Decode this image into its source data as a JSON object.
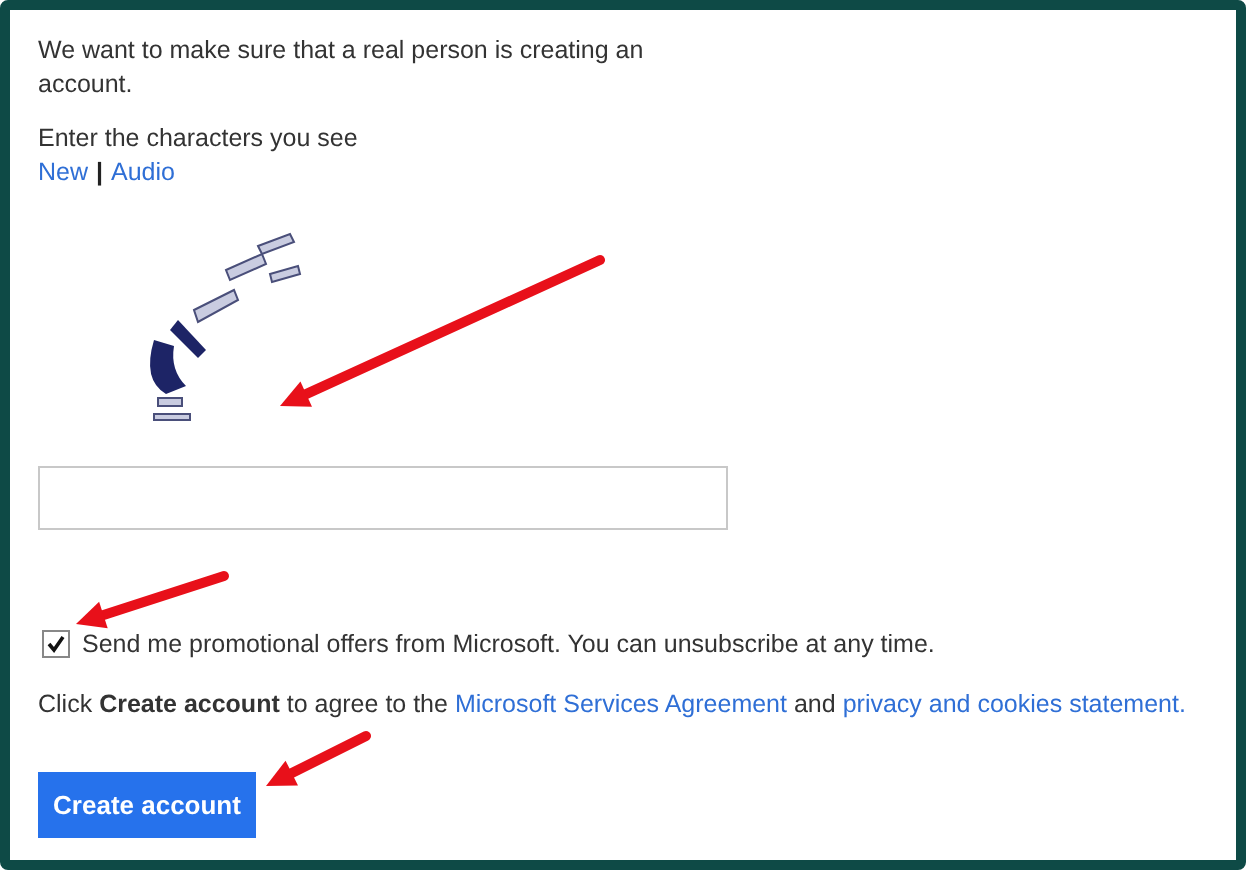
{
  "intro": "We want to make sure that a real person is creating an account.",
  "prompt": "Enter the characters you see",
  "captcha_links": [
    {
      "label": "New"
    },
    {
      "label": "Audio"
    }
  ],
  "captcha_separator": "|",
  "promo": {
    "label": "Send me promotional offers from Microsoft. You can unsubscribe at any time.",
    "checked": true
  },
  "agreement": [
    {
      "kind": "text",
      "text": "Click **Create account** to agree to the"
    },
    {
      "kind": "link",
      "text": "Microsoft Services Agreement"
    },
    {
      "kind": "text",
      "text": "and"
    },
    {
      "kind": "link",
      "text": "privacy and cookies statement."
    }
  ],
  "button": "Create account"
}
